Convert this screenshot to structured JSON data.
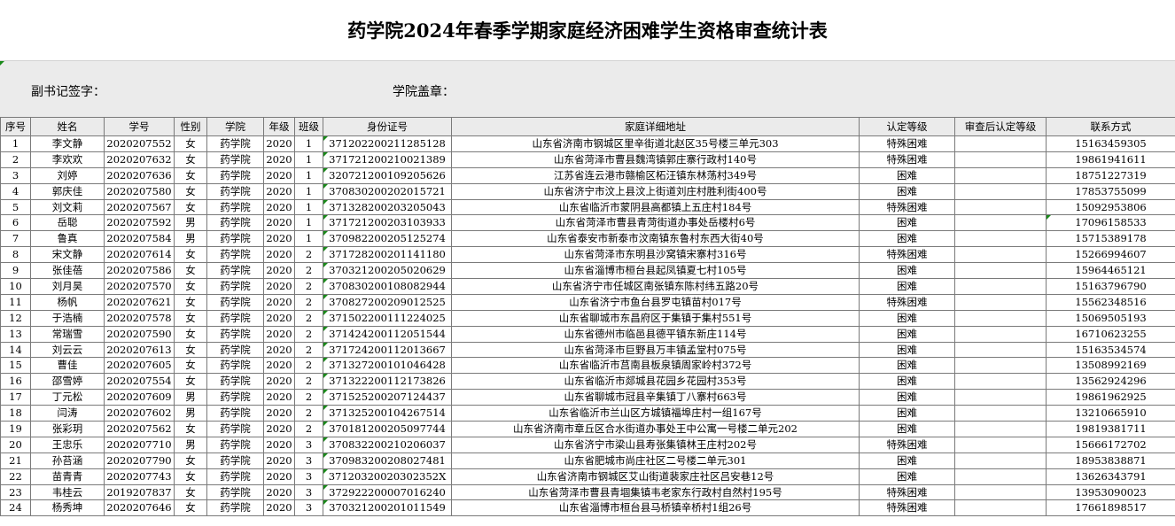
{
  "title": "药学院2024年春季学期家庭经济困难学生资格审查统计表",
  "signatures": {
    "deputy_secretary_label": "副书记签字：",
    "college_seal_label": "学院盖章："
  },
  "table": {
    "headers": [
      "序号",
      "姓名",
      "学号",
      "性别",
      "学院",
      "年级",
      "班级",
      "身份证号",
      "家庭详细地址",
      "认定等级",
      "审查后认定等级",
      "联系方式"
    ],
    "rows": [
      [
        "1",
        "李文静",
        "2020207552",
        "女",
        "药学院",
        "2020",
        "1",
        "371202200211285128",
        "山东省济南市钢城区里辛街道北赵区35号楼三单元303",
        "特殊困难",
        "",
        "15163459305"
      ],
      [
        "2",
        "李欢欢",
        "2020207632",
        "女",
        "药学院",
        "2020",
        "1",
        "371721200210021389",
        "山东省菏泽市曹县魏湾镇郭庄寨行政村140号",
        "特殊困难",
        "",
        "19861941611"
      ],
      [
        "3",
        "刘婷",
        "2020207636",
        "女",
        "药学院",
        "2020",
        "1",
        "320721200109205626",
        "江苏省连云港市赣榆区柘汪镇东林荡村349号",
        "困难",
        "",
        "18751227319"
      ],
      [
        "4",
        "郭庆佳",
        "2020207580",
        "女",
        "药学院",
        "2020",
        "1",
        "370830200202015721",
        "山东省济宁市汶上县汶上街道刘庄村胜利街400号",
        "困难",
        "",
        "17853755099"
      ],
      [
        "5",
        "刘文莉",
        "2020207567",
        "女",
        "药学院",
        "2020",
        "1",
        "371328200203205043",
        "山东省临沂市蒙阴县高都镇上五庄村184号",
        "特殊困难",
        "",
        "15092953806"
      ],
      [
        "6",
        "岳聪",
        "2020207592",
        "男",
        "药学院",
        "2020",
        "1",
        "371721200203103933",
        "山东省菏泽市曹县青菏街道办事处岳楼村6号",
        "困难",
        "",
        "17096158533"
      ],
      [
        "7",
        "鲁真",
        "2020207584",
        "男",
        "药学院",
        "2020",
        "1",
        "370982200205125274",
        "山东省泰安市新泰市汶南镇东鲁村东西大街40号",
        "困难",
        "",
        "15715389178"
      ],
      [
        "8",
        "宋文静",
        "2020207614",
        "女",
        "药学院",
        "2020",
        "2",
        "371728200201141180",
        "山东省菏泽市东明县沙窝镇宋寨村316号",
        "特殊困难",
        "",
        "15266994607"
      ],
      [
        "9",
        "张佳蓓",
        "2020207586",
        "女",
        "药学院",
        "2020",
        "2",
        "370321200205020629",
        "山东省淄博市桓台县起凤镇夏七村105号",
        "困难",
        "",
        "15964465121"
      ],
      [
        "10",
        "刘月昊",
        "2020207570",
        "女",
        "药学院",
        "2020",
        "2",
        "370830200108082944",
        "山东省济宁市任城区南张镇东陈村纬五路20号",
        "困难",
        "",
        "15163796790"
      ],
      [
        "11",
        "杨帆",
        "2020207621",
        "女",
        "药学院",
        "2020",
        "2",
        "370827200209012525",
        "山东省济宁市鱼台县罗屯镇苗村017号",
        "特殊困难",
        "",
        "15562348516"
      ],
      [
        "12",
        "于浩楠",
        "2020207578",
        "女",
        "药学院",
        "2020",
        "2",
        "371502200111224025",
        "山东省聊城市东昌府区于集镇于集村551号",
        "困难",
        "",
        "15069505193"
      ],
      [
        "13",
        "常瑞雪",
        "2020207590",
        "女",
        "药学院",
        "2020",
        "2",
        "371424200112051544",
        "山东省德州市临邑县德平镇东新庄114号",
        "困难",
        "",
        "16710623255"
      ],
      [
        "14",
        "刘云云",
        "2020207613",
        "女",
        "药学院",
        "2020",
        "2",
        "371724200112013667",
        "山东省菏泽市巨野县万丰镇孟堂村075号",
        "困难",
        "",
        "15163534574"
      ],
      [
        "15",
        "曹佳",
        "2020207605",
        "女",
        "药学院",
        "2020",
        "2",
        "371327200101046428",
        "山东省临沂市莒南县板泉镇周家岭村372号",
        "困难",
        "",
        "13508992169"
      ],
      [
        "16",
        "邵雪婷",
        "2020207554",
        "女",
        "药学院",
        "2020",
        "2",
        "371322200112173826",
        "山东省临沂市郯城县花园乡花园村353号",
        "困难",
        "",
        "13562924296"
      ],
      [
        "17",
        "丁元松",
        "2020207609",
        "男",
        "药学院",
        "2020",
        "2",
        "371525200207124437",
        "山东省聊城市冠县辛集镇丁八寨村663号",
        "困难",
        "",
        "19861962925"
      ],
      [
        "18",
        "闫涛",
        "2020207602",
        "男",
        "药学院",
        "2020",
        "2",
        "371325200104267514",
        "山东省临沂市兰山区方城镇福埠庄村一组167号",
        "困难",
        "",
        "13210665910"
      ],
      [
        "19",
        "张彩玥",
        "2020207562",
        "女",
        "药学院",
        "2020",
        "2",
        "370181200205097744",
        "山东省济南市章丘区合水街道办事处王中公寓一号楼二单元202",
        "困难",
        "",
        "19819381711"
      ],
      [
        "20",
        "王忠乐",
        "2020207710",
        "男",
        "药学院",
        "2020",
        "3",
        "370832200210206037",
        "山东省济宁市梁山县寿张集镇林王庄村202号",
        "特殊困难",
        "",
        "15666172702"
      ],
      [
        "21",
        "孙苔涵",
        "2020207790",
        "女",
        "药学院",
        "2020",
        "3",
        "370983200208027481",
        "山东省肥城市尚庄社区二号楼二单元301",
        "困难",
        "",
        "18953838871"
      ],
      [
        "22",
        "苗青青",
        "2020207743",
        "女",
        "药学院",
        "2020",
        "3",
        "37120320020302352X",
        "山东省济南市钢城区艾山街道裴家庄社区吕安巷12号",
        "困难",
        "",
        "13626343791"
      ],
      [
        "23",
        "韦桂云",
        "2019207837",
        "女",
        "药学院",
        "2020",
        "3",
        "372922200007016240",
        "山东省菏泽市曹县青堌集镇韦老家东行政村自然村195号",
        "特殊困难",
        "",
        "13953090023"
      ],
      [
        "24",
        "杨秀坤",
        "2020207646",
        "女",
        "药学院",
        "2020",
        "3",
        "370321200201011549",
        "山东省淄博市桓台县马桥镇辛桥村1组26号",
        "特殊困难",
        "",
        "17661898517"
      ]
    ]
  }
}
